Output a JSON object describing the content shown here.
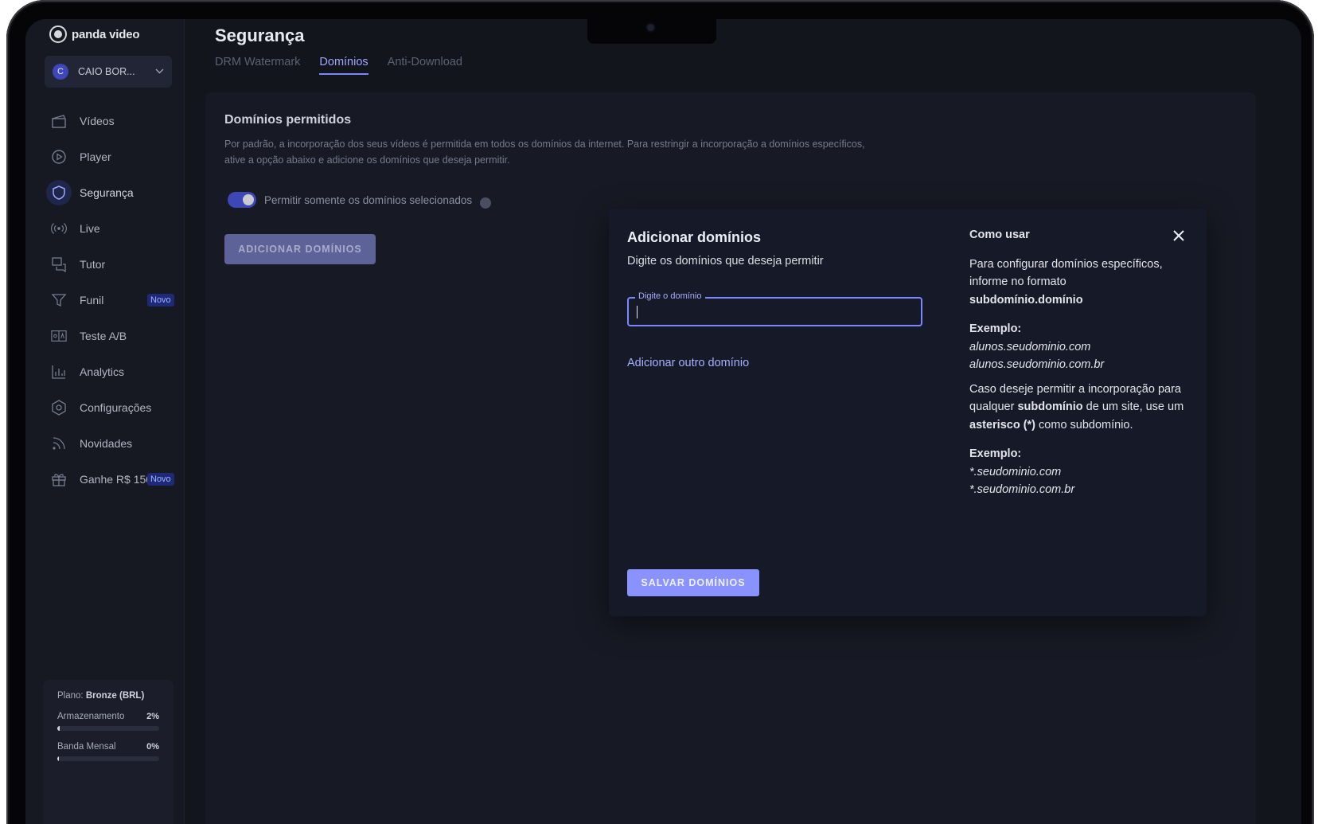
{
  "brand": {
    "name": "panda video"
  },
  "account": {
    "initial": "C",
    "name": "CAIO BOR..."
  },
  "sidebar": {
    "items": [
      {
        "label": "Vídeos",
        "icon": "clapperboard-icon"
      },
      {
        "label": "Player",
        "icon": "play-circle-icon"
      },
      {
        "label": "Segurança",
        "icon": "shield-icon"
      },
      {
        "label": "Live",
        "icon": "broadcast-icon"
      },
      {
        "label": "Tutor",
        "icon": "chat-bubbles-icon"
      },
      {
        "label": "Funil",
        "icon": "funnel-icon",
        "badge": "Novo"
      },
      {
        "label": "Teste A/B",
        "icon": "ab-test-icon"
      },
      {
        "label": "Analytics",
        "icon": "bar-chart-icon"
      },
      {
        "label": "Configurações",
        "icon": "gear-icon"
      },
      {
        "label": "Novidades",
        "icon": "rss-icon"
      },
      {
        "label": "Ganhe R$ 150",
        "icon": "gift-icon",
        "badge": "Novo"
      }
    ],
    "active_index": 2
  },
  "plan": {
    "label": "Plano:",
    "name": "Bronze (BRL)",
    "storage_label": "Armazenamento",
    "storage_value": "2%",
    "storage_fraction": 0.02,
    "bandwidth_label": "Banda Mensal",
    "bandwidth_value": "0%",
    "bandwidth_fraction": 0.0
  },
  "page": {
    "title": "Segurança",
    "tabs": [
      "DRM Watermark",
      "Domínios",
      "Anti-Download"
    ],
    "active_tab": 1
  },
  "section": {
    "title": "Domínios permitidos",
    "description": "Por padrão, a incorporação dos seus vídeos é permitida em todos os domínios da internet. Para restringir a incorporação a domínios específicos, ative a opção abaixo e adicione os domínios que deseja permitir.",
    "toggle_label": "Permitir somente os domínios selecionados",
    "toggle_on": true,
    "add_button": "ADICIONAR DOMÍNIOS"
  },
  "modal": {
    "title": "Adicionar domínios",
    "subtitle": "Digite os domínios que deseja permitir",
    "input_label": "Digite o domínio",
    "input_value": "",
    "add_other": "Adicionar outro domínio",
    "save_button": "SALVAR DOMÍNIOS",
    "help": {
      "title": "Como usar",
      "p1_text": "Para configurar domínios específicos, informe no formato",
      "p1_bold": "subdomínio.domínio",
      "example_label": "Exemplo:",
      "examples1": [
        "alunos.seudominio.com",
        "alunos.seudominio.com.br"
      ],
      "p2_a": "Caso deseje permitir a incorporação para qualquer",
      "p2_bold1": "subdomínio",
      "p2_b": "de um site, use um",
      "p2_bold2": "asterisco (*)",
      "p2_c": "como subdomínio.",
      "example_label2": "Exemplo:",
      "examples2": [
        "*.seudominio.com",
        "*.seudominio.com.br"
      ]
    }
  },
  "colors": {
    "accent": "#7a86ff",
    "background": "#13151d",
    "sidebar": "#161822",
    "modal": "#161927"
  }
}
